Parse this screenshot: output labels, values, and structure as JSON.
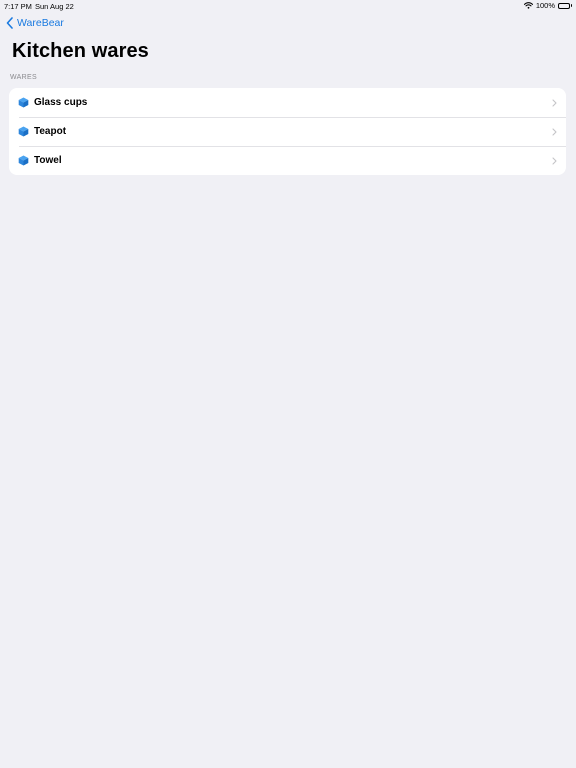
{
  "status_bar": {
    "time": "7:17 PM",
    "date": "Sun Aug 22",
    "battery": "100%",
    "wifi_icon": "wifi-icon",
    "battery_icon": "battery-icon"
  },
  "nav": {
    "back_label": "WareBear",
    "back_icon": "chevron-left-icon"
  },
  "page": {
    "title": "Kitchen wares"
  },
  "section": {
    "header": "WARES",
    "items": [
      {
        "label": "Glass cups",
        "icon": "cube-icon"
      },
      {
        "label": "Teapot",
        "icon": "cube-icon"
      },
      {
        "label": "Towel",
        "icon": "cube-icon"
      }
    ]
  },
  "colors": {
    "accent": "#1a7ae0",
    "background": "#f0f0f5",
    "card": "#ffffff",
    "secondary_text": "#8a8a8e"
  }
}
